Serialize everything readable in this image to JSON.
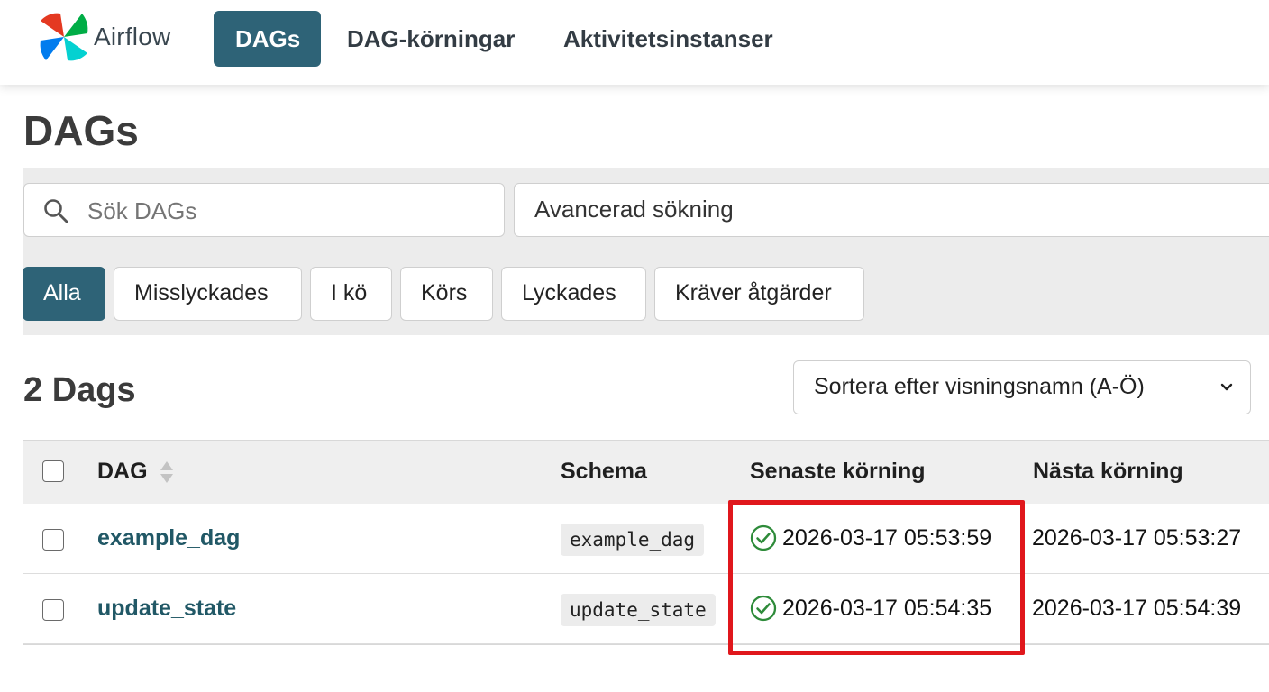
{
  "app": {
    "name": "Airflow"
  },
  "nav": {
    "items": [
      {
        "label": "DAGs",
        "active": true
      },
      {
        "label": "DAG-körningar",
        "active": false
      },
      {
        "label": "Aktivitetsinstanser",
        "active": false
      }
    ]
  },
  "page": {
    "title": "DAGs"
  },
  "search": {
    "placeholder": "Sök DAGs",
    "value": "",
    "advanced_label": "Avancerad sökning"
  },
  "filters": [
    {
      "label": "Alla",
      "active": true
    },
    {
      "label": "Misslyckades",
      "active": false
    },
    {
      "label": "I kö",
      "active": false
    },
    {
      "label": "Körs",
      "active": false
    },
    {
      "label": "Lyckades",
      "active": false
    },
    {
      "label": "Kräver åtgärder",
      "active": false
    }
  ],
  "results": {
    "count_label": "2 Dags"
  },
  "sort": {
    "selected": "Sortera efter visningsnamn (A-Ö)"
  },
  "table": {
    "headers": {
      "dag": "DAG",
      "schedule": "Schema",
      "last_run": "Senaste körning",
      "next_run": "Nästa körning"
    },
    "rows": [
      {
        "dag": "example_dag",
        "schedule": "example_dag",
        "last_run": "2026-03-17 05:53:59",
        "last_run_status": "success",
        "next_run": "2026-03-17 05:53:27"
      },
      {
        "dag": "update_state",
        "schedule": "update_state",
        "last_run": "2026-03-17 05:54:35",
        "last_run_status": "success",
        "next_run": "2026-03-17 05:54:39"
      }
    ]
  },
  "colors": {
    "primary": "#2e6377",
    "link": "#215866",
    "success": "#2e8b3a",
    "highlight": "#e0171c"
  },
  "icons": {
    "logo": "airflow-pinwheel-logo",
    "search": "search-icon",
    "sort": "sort-arrows-icon",
    "dropdown": "chevron-down-icon",
    "status": "check-circle-icon"
  }
}
